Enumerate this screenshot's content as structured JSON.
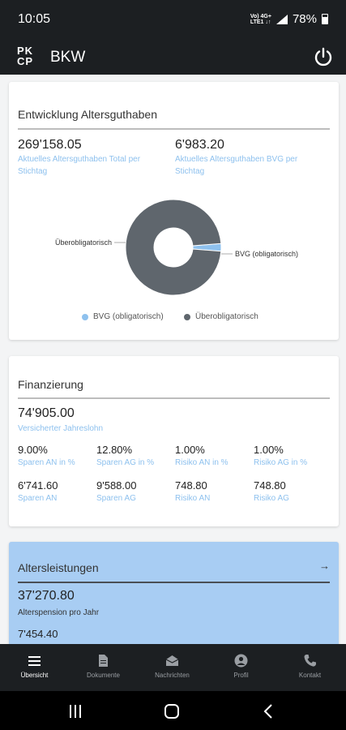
{
  "status_bar": {
    "time": "10:05",
    "network": "VoLTE 4G+",
    "battery": "78%"
  },
  "app_bar": {
    "logo_line1": "PK",
    "logo_line2": "CP",
    "title": "BKW",
    "power_icon": "power-icon"
  },
  "entwicklung": {
    "title": "Entwicklung Altersguthaben",
    "total_value": "269'158.05",
    "total_label": "Aktuelles Altersguthaben Total per Stichtag",
    "bvg_value": "6'983.20",
    "bvg_label": "Aktuelles Altersguthaben BVG per Stichtag",
    "chart_data": {
      "type": "pie",
      "categories": [
        "BVG (obligatorisch)",
        "Überobligatorisch"
      ],
      "values": [
        6983.2,
        262174.85
      ],
      "colors": [
        "#8ec1ee",
        "#5f666d"
      ],
      "donut": true,
      "legend": "bottom"
    },
    "slice_label_bvg": "BVG (obligatorisch)",
    "slice_label_ueber": "Überobligatorisch",
    "legend_bvg": "BVG (obligatorisch)",
    "legend_ueber": "Überobligatorisch"
  },
  "finanzierung": {
    "title": "Finanzierung",
    "salary_value": "74'905.00",
    "salary_label": "Versicherter Jahreslohn",
    "row1": [
      {
        "value": "9.00%",
        "label": "Sparen AN in %"
      },
      {
        "value": "12.80%",
        "label": "Sparen AG in %"
      },
      {
        "value": "1.00%",
        "label": "Risiko AN in %"
      },
      {
        "value": "1.00%",
        "label": "Risiko AG in %"
      }
    ],
    "row2": [
      {
        "value": "6'741.60",
        "label": "Sparen AN"
      },
      {
        "value": "9'588.00",
        "label": "Sparen AG"
      },
      {
        "value": "748.80",
        "label": "Risiko AN"
      },
      {
        "value": "748.80",
        "label": "Risiko AG"
      }
    ]
  },
  "altersleistungen": {
    "title": "Altersleistungen",
    "arrow": "→",
    "pension_value": "37'270.80",
    "pension_label": "Alterspension pro Jahr",
    "next_value": "7'454.40"
  },
  "bottom_nav": [
    {
      "label": "Übersicht",
      "icon": "list-icon",
      "active": true
    },
    {
      "label": "Dokumente",
      "icon": "document-icon",
      "active": false
    },
    {
      "label": "Nachrichten",
      "icon": "mail-icon",
      "active": false
    },
    {
      "label": "Profil",
      "icon": "profile-icon",
      "active": false
    },
    {
      "label": "Kontakt",
      "icon": "phone-icon",
      "active": false
    }
  ]
}
